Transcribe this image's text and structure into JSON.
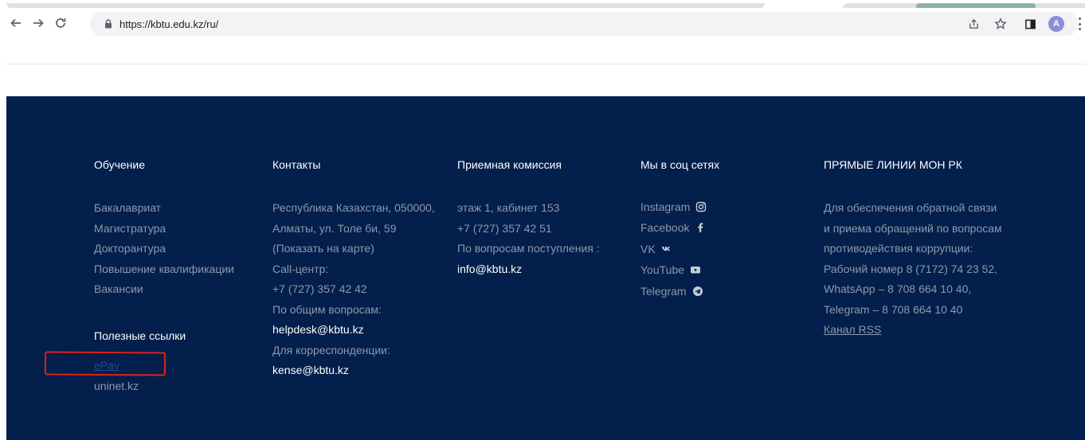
{
  "browser": {
    "url": "https://kbtu.edu.kz/ru/",
    "profile_initial": "A"
  },
  "footer": {
    "education": {
      "title": "Обучение",
      "items": [
        "Бакалавриат",
        "Магистратура",
        "Докторантура",
        "Повышение квалификации",
        "Вакансии"
      ]
    },
    "useful_links": {
      "title": "Полезные ссылки",
      "items": [
        "ePay",
        "uninet.kz"
      ]
    },
    "contacts": {
      "title": "Контакты",
      "address_line1": "Республика Казахстан, 050000,",
      "address_line2": "Алматы, ул. Толе би, 59",
      "map_link": "(Показать на карте)",
      "callcenter_label": "Call-центр:",
      "callcenter_phone": "+7 (727) 357 42 42",
      "general_label": "По общим вопросам:",
      "general_email": "helpdesk@kbtu.kz",
      "correspondence_label": "Для корреспонденции:",
      "correspondence_email": "kense@kbtu.kz"
    },
    "admissions": {
      "title": "Приемная комиссия",
      "room": "этаж 1, кабинет 153",
      "phone": "+7 (727) 357 42 51",
      "admission_label": "По вопросам поступления :",
      "admission_email": "info@kbtu.kz"
    },
    "social": {
      "title": "Мы в соц сетях",
      "items": [
        {
          "label": "Instagram",
          "icon": "instagram-icon"
        },
        {
          "label": "Facebook",
          "icon": "facebook-icon"
        },
        {
          "label": "VK",
          "icon": "vk-icon"
        },
        {
          "label": "YouTube",
          "icon": "youtube-icon"
        },
        {
          "label": "Telegram",
          "icon": "telegram-icon"
        }
      ]
    },
    "mon": {
      "title": "ПРЯМЫЕ ЛИНИИ МОН РК",
      "lines": [
        "Для обеспечения обратной связи",
        "и приема обращений по вопросам",
        "противодействия коррупции:",
        "Рабочий номер 8 (7172) 74 23 52,",
        "WhatsApp – 8 708 664 10 40,",
        "Telegram – 8 708 664 10 40"
      ],
      "rss": "Канал RSS"
    }
  },
  "colors": {
    "footer_bg": "#031f4b",
    "footer_text": "#8d98ad",
    "heading": "#ffffff",
    "annotation": "#e0201b"
  }
}
